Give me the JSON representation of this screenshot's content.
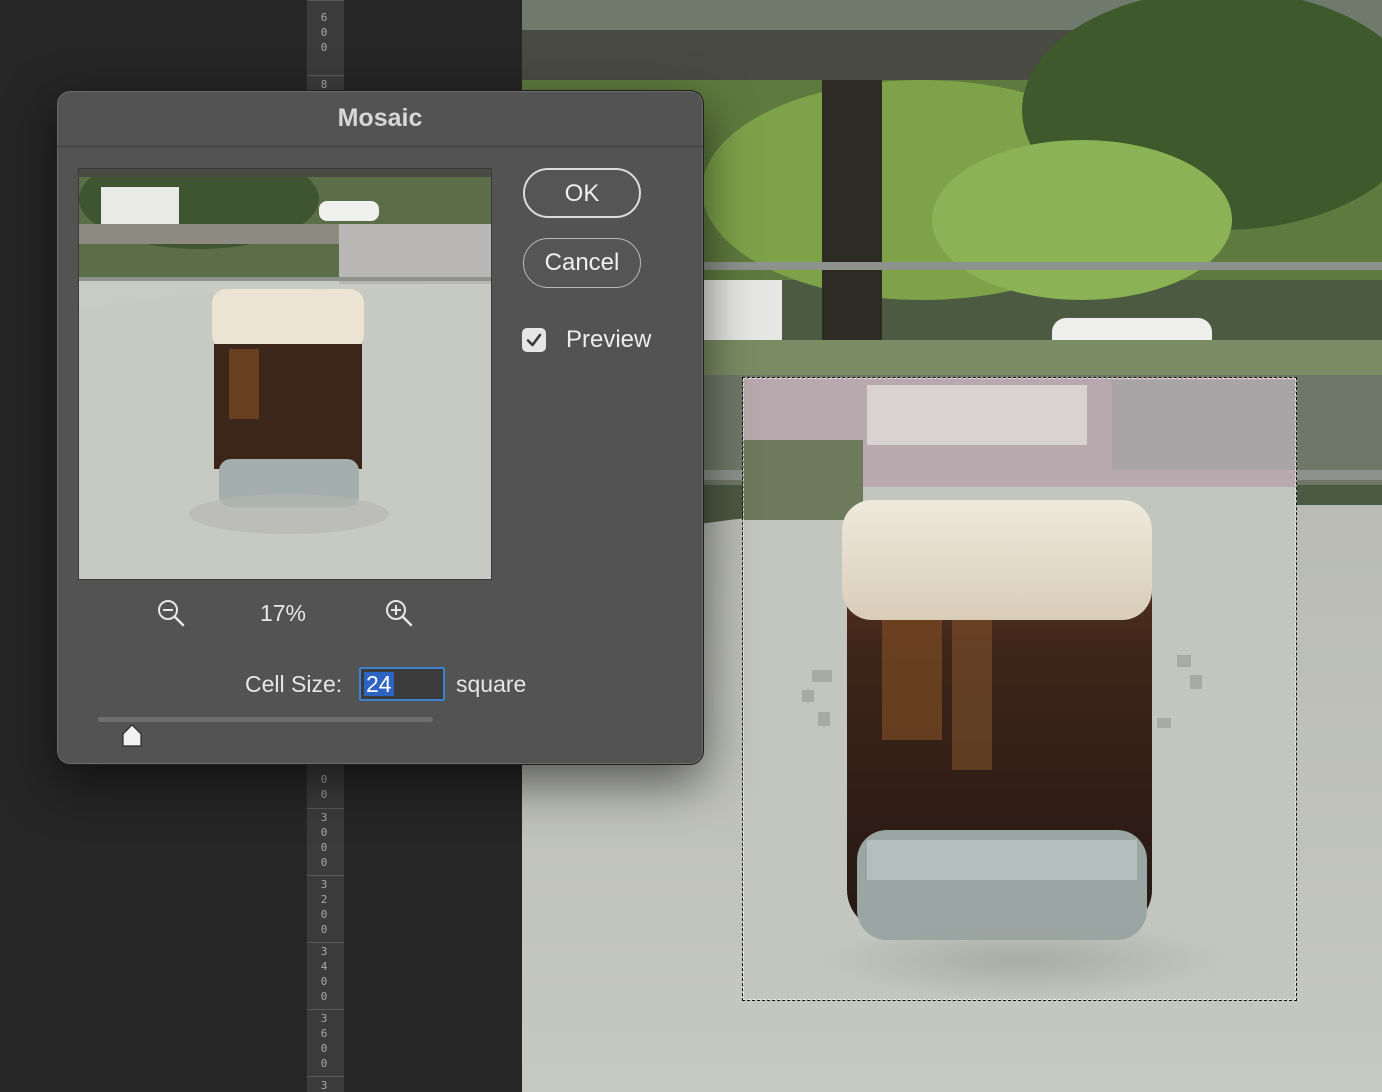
{
  "ruler": {
    "labels": [
      "600",
      "8",
      "0 0",
      "3000",
      "3200",
      "3400",
      "3600",
      "3"
    ]
  },
  "dialog": {
    "title": "Mosaic",
    "zoom": {
      "percent": "17%",
      "zoom_out_icon": "zoom-out-icon",
      "zoom_in_icon": "zoom-in-icon"
    },
    "buttons": {
      "ok": "OK",
      "cancel": "Cancel"
    },
    "preview": {
      "label": "Preview",
      "checked": true
    },
    "cell_size": {
      "label": "Cell Size:",
      "value": "24",
      "unit": "square",
      "slider_fraction": 0.07
    }
  },
  "colors": {
    "dialog_bg": "#535353",
    "accent": "#2d64c4",
    "workspace_bg": "#262626"
  }
}
